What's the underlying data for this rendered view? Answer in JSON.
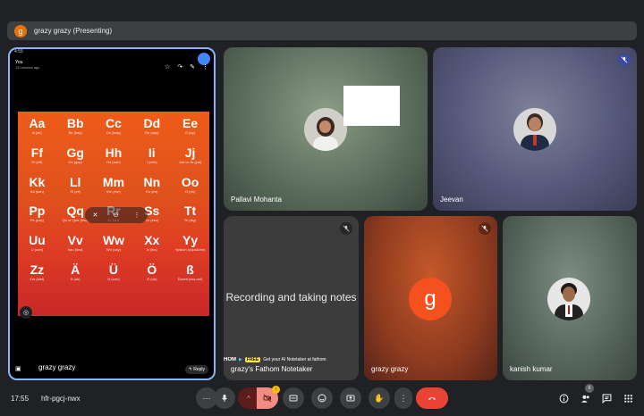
{
  "presenting_bar": {
    "avatar_letter": "g",
    "text": "grazy grazy (Presenting)"
  },
  "presenter_tile": {
    "status_time": "4:55",
    "header_title": "You",
    "header_sub": "13 minutes ago",
    "name": "grazy grazy",
    "reply_label": "Reply",
    "alphabet": [
      {
        "big": "Aa",
        "small": "A (ah)"
      },
      {
        "big": "Bb",
        "small": "Be (bay)"
      },
      {
        "big": "Cc",
        "small": "Ce (tsay)"
      },
      {
        "big": "Dd",
        "small": "De (day)"
      },
      {
        "big": "Ee",
        "small": "E (ay)"
      },
      {
        "big": "Ff",
        "small": "Ef (eff)"
      },
      {
        "big": "Gg",
        "small": "Ge (gay)"
      },
      {
        "big": "Hh",
        "small": "Ha (hah)"
      },
      {
        "big": "Ii",
        "small": "I (eeh)"
      },
      {
        "big": "Jj",
        "small": "Jott or Je (yot)"
      },
      {
        "big": "Kk",
        "small": "Ka (kah)"
      },
      {
        "big": "Ll",
        "small": "El (ell)"
      },
      {
        "big": "Mm",
        "small": "Em (em)"
      },
      {
        "big": "Nn",
        "small": "En (en)"
      },
      {
        "big": "Oo",
        "small": "O (oh)"
      },
      {
        "big": "Pp",
        "small": "Pe (pay)"
      },
      {
        "big": "Qq",
        "small": "Qu or Que (koo)"
      },
      {
        "big": "Rr",
        "small": "Er (err)"
      },
      {
        "big": "Ss",
        "small": "Es (ess)"
      },
      {
        "big": "Tt",
        "small": "Te (tay)"
      },
      {
        "big": "Uu",
        "small": "U (ooh)"
      },
      {
        "big": "Vv",
        "small": "Vau (fow)"
      },
      {
        "big": "Ww",
        "small": "We (vay)"
      },
      {
        "big": "Xx",
        "small": "Ix (iks)"
      },
      {
        "big": "Yy",
        "small": "Ypsilon (oopsilohn)"
      },
      {
        "big": "Zz",
        "small": "Zet (tset)"
      },
      {
        "big": "Ä",
        "small": "Ä (air)"
      },
      {
        "big": "Ü",
        "small": "Ü (ooh)"
      },
      {
        "big": "Ö",
        "small": "Ö (uh)"
      },
      {
        "big": "ß",
        "small": "Eszett (ess-set)"
      }
    ]
  },
  "tiles": {
    "pallavi": {
      "name": "Pallavi Mohanta"
    },
    "jeevan": {
      "name": "Jeevan"
    },
    "fathom": {
      "name": "grazy's Fathom Notetaker",
      "message": "Recording and taking notes",
      "brand": "HOM",
      "free": "FREE",
      "banner": "Get your AI Notetaker at fathom"
    },
    "grazy": {
      "name": "grazy grazy",
      "avatar_letter": "g"
    },
    "kanish": {
      "name": "kanish kumar"
    }
  },
  "bottom_bar": {
    "time": "17:55",
    "meeting_code": "hfr-pgcj-nwx",
    "more_label": "⋯",
    "cam_badge": "!",
    "people_count": "6"
  },
  "colors": {
    "accent_blue": "#8ab4f8",
    "end_call_red": "#ea4335",
    "avatar_orange": "#f4511e"
  }
}
